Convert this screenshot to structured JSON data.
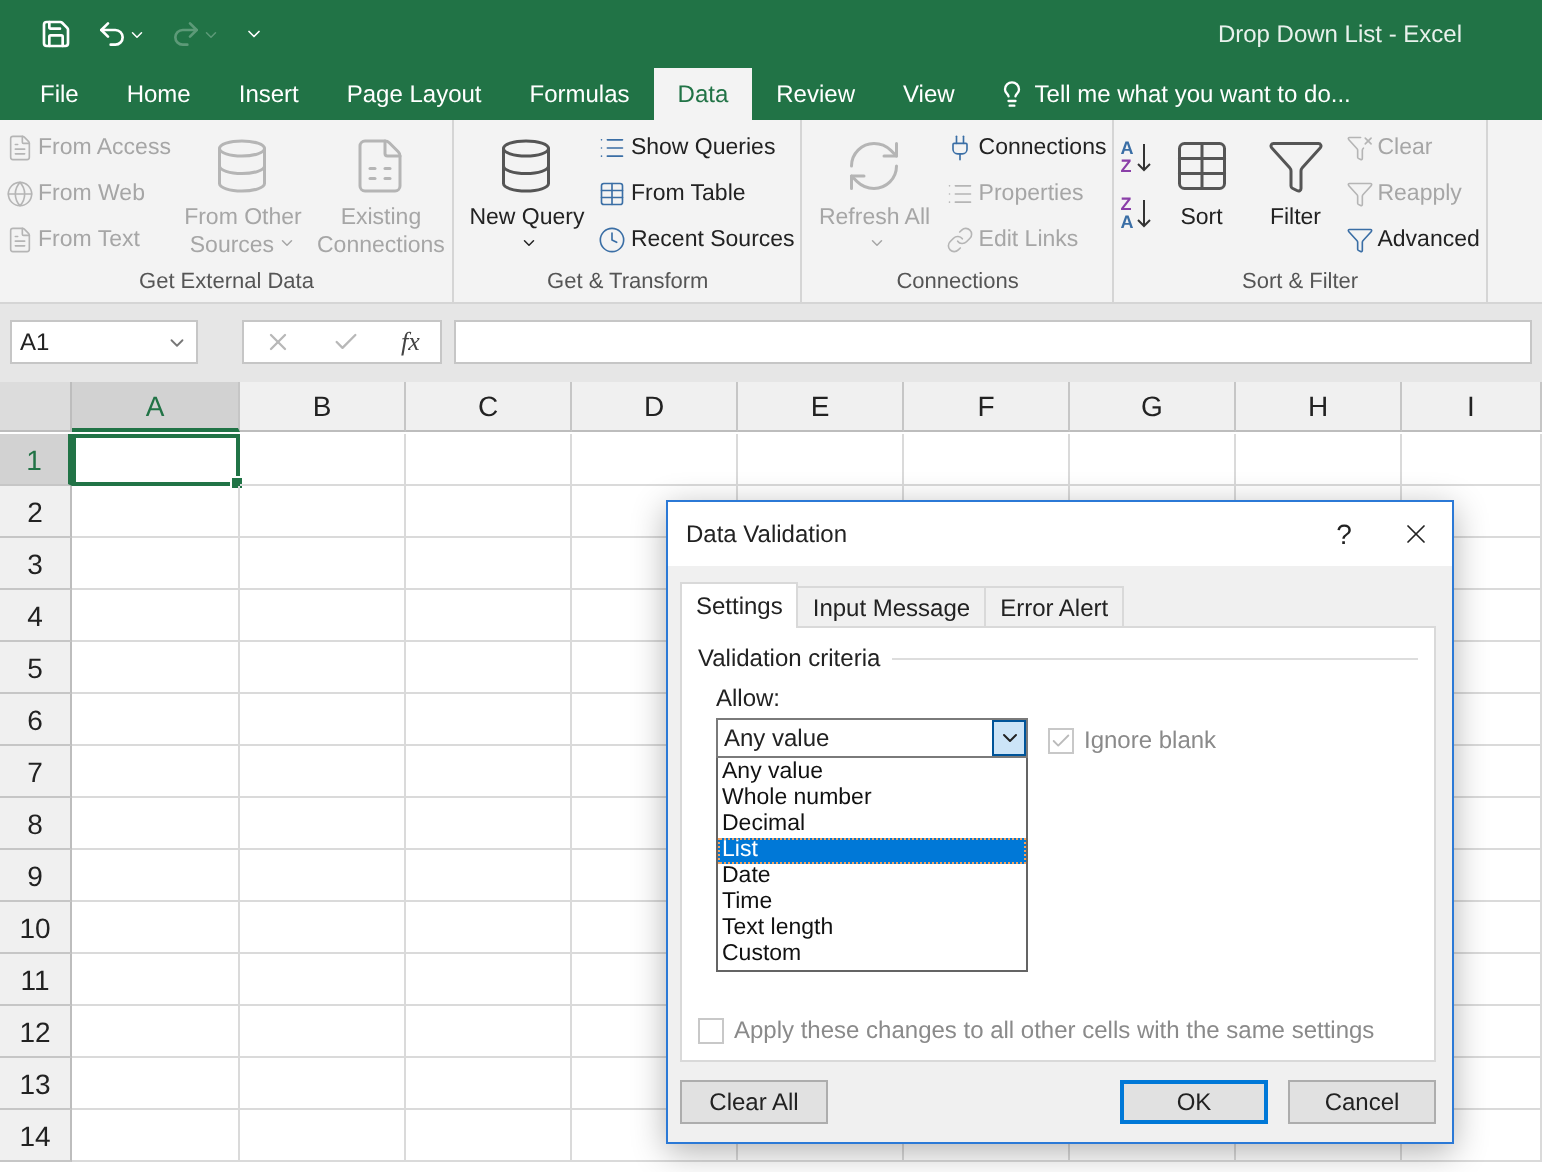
{
  "title_bar": {
    "title": "Drop Down List - Excel"
  },
  "ribbon_tabs": [
    {
      "label": "File",
      "selected": false
    },
    {
      "label": "Home",
      "selected": false
    },
    {
      "label": "Insert",
      "selected": false
    },
    {
      "label": "Page Layout",
      "selected": false
    },
    {
      "label": "Formulas",
      "selected": false
    },
    {
      "label": "Data",
      "selected": true
    },
    {
      "label": "Review",
      "selected": false
    },
    {
      "label": "View",
      "selected": false
    }
  ],
  "tell_me": "Tell me what you want to do...",
  "ribbon_groups": [
    {
      "label": "Get External Data",
      "columns": [
        {
          "kind": "stack",
          "items": [
            {
              "label": "From Access",
              "disabled": true
            },
            {
              "label": "From Web",
              "disabled": true
            },
            {
              "label": "From Text",
              "disabled": true
            }
          ]
        },
        {
          "kind": "large",
          "label": "From Other Sources",
          "disabled": true,
          "caret": true
        },
        {
          "kind": "large",
          "label": "Existing Connections",
          "disabled": true,
          "caret": false
        }
      ]
    },
    {
      "label": "Get & Transform",
      "columns": [
        {
          "kind": "large",
          "label": "New Query",
          "disabled": false,
          "caret": true
        },
        {
          "kind": "stack",
          "items": [
            {
              "label": "Show Queries",
              "disabled": false
            },
            {
              "label": "From Table",
              "disabled": false
            },
            {
              "label": "Recent Sources",
              "disabled": false
            }
          ]
        }
      ]
    },
    {
      "label": "Connections",
      "columns": [
        {
          "kind": "large",
          "label": "Refresh All",
          "disabled": true,
          "caret": true
        },
        {
          "kind": "stack",
          "items": [
            {
              "label": "Connections",
              "disabled": false
            },
            {
              "label": "Properties",
              "disabled": true
            },
            {
              "label": "Edit Links",
              "disabled": true
            }
          ]
        }
      ]
    },
    {
      "label": "Sort & Filter",
      "columns": [
        {
          "kind": "sort_icons",
          "buttons": [
            [
              "A",
              "Z"
            ],
            [
              "Z",
              "A"
            ]
          ]
        },
        {
          "kind": "large",
          "label": "Sort",
          "disabled": false,
          "caret": false
        },
        {
          "kind": "large",
          "label": "Filter",
          "disabled": false,
          "caret": false
        },
        {
          "kind": "stack",
          "items": [
            {
              "label": "Clear",
              "disabled": true
            },
            {
              "label": "Reapply",
              "disabled": true
            },
            {
              "label": "Advanced",
              "disabled": false
            }
          ]
        }
      ]
    }
  ],
  "formula_bar": {
    "name_box": "A1",
    "function_label": "fx"
  },
  "sheet": {
    "columns": [
      {
        "label": "A",
        "selected": true
      },
      {
        "label": "B",
        "selected": false
      },
      {
        "label": "C",
        "selected": false
      },
      {
        "label": "D",
        "selected": false
      },
      {
        "label": "E",
        "selected": false
      },
      {
        "label": "F",
        "selected": false
      },
      {
        "label": "G",
        "selected": false
      },
      {
        "label": "H",
        "selected": false
      },
      {
        "label": "I",
        "selected": false
      }
    ],
    "rows": [
      {
        "label": "1",
        "selected": true
      },
      {
        "label": "2",
        "selected": false
      },
      {
        "label": "3",
        "selected": false
      },
      {
        "label": "4",
        "selected": false
      },
      {
        "label": "5",
        "selected": false
      },
      {
        "label": "6",
        "selected": false
      },
      {
        "label": "7",
        "selected": false
      },
      {
        "label": "8",
        "selected": false
      },
      {
        "label": "9",
        "selected": false
      },
      {
        "label": "10",
        "selected": false
      },
      {
        "label": "11",
        "selected": false
      },
      {
        "label": "12",
        "selected": false
      },
      {
        "label": "13",
        "selected": false
      },
      {
        "label": "14",
        "selected": false
      }
    ]
  },
  "dialog": {
    "title": "Data Validation",
    "help": "?",
    "tabs": [
      {
        "label": "Settings",
        "selected": true
      },
      {
        "label": "Input Message",
        "selected": false
      },
      {
        "label": "Error Alert",
        "selected": false
      }
    ],
    "section": "Validation criteria",
    "allow_label": "Allow:",
    "allow_value": "Any value",
    "allow_options": [
      {
        "label": "Any value",
        "selected": false
      },
      {
        "label": "Whole number",
        "selected": false
      },
      {
        "label": "Decimal",
        "selected": false
      },
      {
        "label": "List",
        "selected": true
      },
      {
        "label": "Date",
        "selected": false
      },
      {
        "label": "Time",
        "selected": false
      },
      {
        "label": "Text length",
        "selected": false
      },
      {
        "label": "Custom",
        "selected": false
      }
    ],
    "ignore_blank": {
      "label": "Ignore blank",
      "checked": true,
      "disabled": true
    },
    "apply_all": {
      "label": "Apply these changes to all other cells with the same settings",
      "checked": false,
      "disabled": true
    },
    "buttons": [
      {
        "label": "Clear All",
        "default": false
      },
      {
        "label": "OK",
        "default": true
      },
      {
        "label": "Cancel",
        "default": false
      }
    ]
  }
}
